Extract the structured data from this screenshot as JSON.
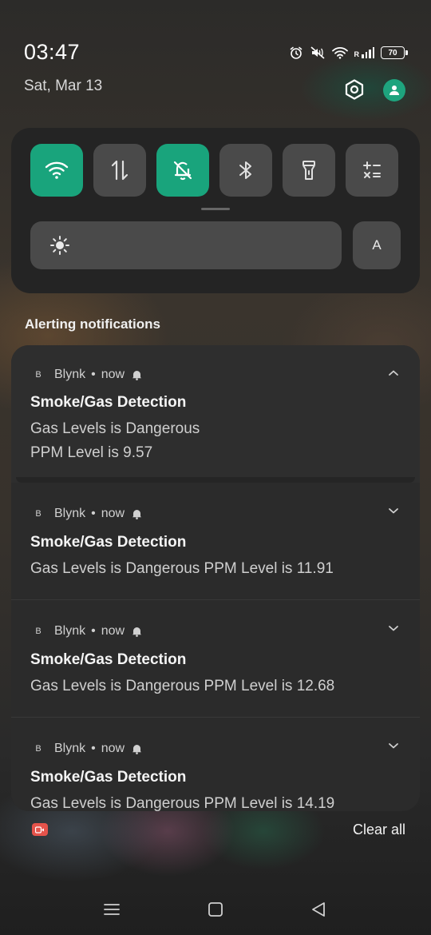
{
  "status_bar": {
    "time": "03:47",
    "date": "Sat, Mar 13",
    "signal_label": "R",
    "battery": "70",
    "icons": [
      "alarm-icon",
      "mute-icon",
      "wifi-icon",
      "signal-icon",
      "battery-icon"
    ]
  },
  "header_buttons": {
    "settings_icon": "settings-hexagon-icon",
    "user_icon": "user-icon",
    "accent_color": "#19a47c"
  },
  "quick_settings": {
    "tiles": [
      {
        "name": "wifi",
        "icon": "wifi-icon",
        "active": true
      },
      {
        "name": "mobile-data",
        "icon": "data-arrows-icon",
        "active": false
      },
      {
        "name": "do-not-disturb",
        "icon": "bell-off-icon",
        "active": true
      },
      {
        "name": "bluetooth",
        "icon": "bluetooth-icon",
        "active": false
      },
      {
        "name": "flashlight",
        "icon": "flashlight-icon",
        "active": false
      },
      {
        "name": "calculator",
        "icon": "calculator-icon",
        "active": false
      }
    ],
    "brightness_icon": "sun-icon",
    "auto_label": "A"
  },
  "section_title": "Alerting notifications",
  "notifications": [
    {
      "app_icon": "B",
      "app": "Blynk",
      "separator": "•",
      "time": "now",
      "title": "Smoke/Gas Detection",
      "line1": "Gas Levels is Dangerous",
      "line2": "PPM Level is 9.57",
      "expanded": true
    },
    {
      "app_icon": "B",
      "app": "Blynk",
      "separator": "•",
      "time": "now",
      "title": "Smoke/Gas Detection",
      "line1": "Gas Levels is Dangerous PPM Level is 11.91",
      "expanded": false
    },
    {
      "app_icon": "B",
      "app": "Blynk",
      "separator": "•",
      "time": "now",
      "title": "Smoke/Gas Detection",
      "line1": "Gas Levels is Dangerous PPM Level is 12.68",
      "expanded": false
    },
    {
      "app_icon": "B",
      "app": "Blynk",
      "separator": "•",
      "time": "now",
      "title": "Smoke/Gas Detection",
      "line1": "Gas Levels is Dangerous PPM Level is 14.19",
      "expanded": false
    }
  ],
  "footer": {
    "clear_all": "Clear all",
    "screen_record_icon": "screen-record-icon"
  },
  "nav": [
    "menu-icon",
    "home-icon",
    "back-icon"
  ]
}
